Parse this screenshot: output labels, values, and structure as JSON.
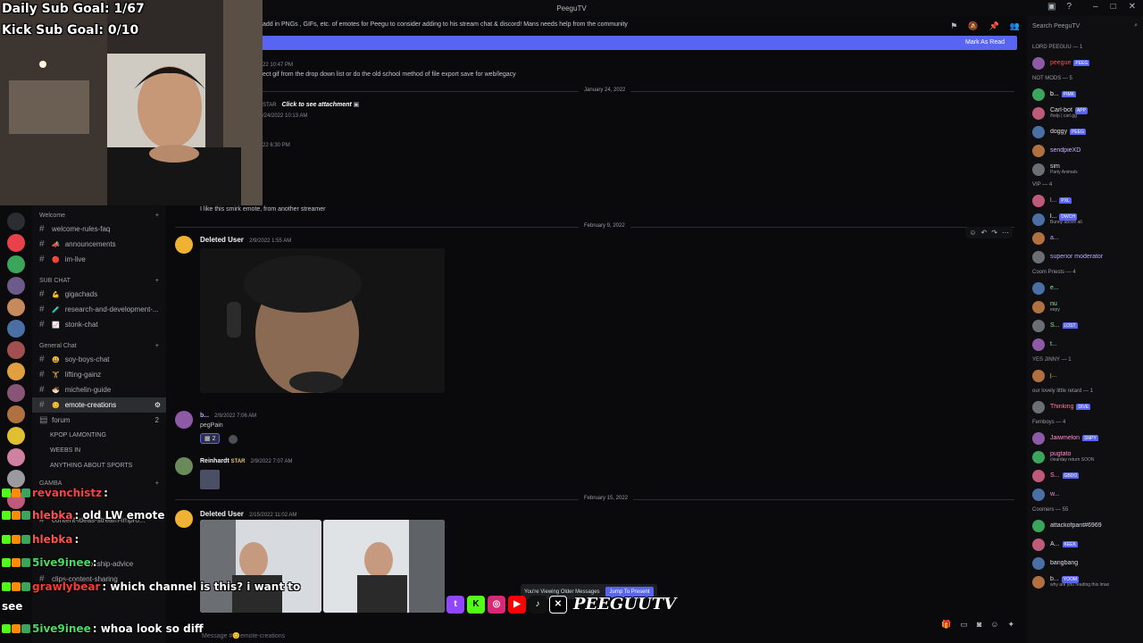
{
  "window": {
    "title": "PeeguTV"
  },
  "overlay": {
    "daily_goal": "Daily Sub Goal: 1/67",
    "kick_goal": "Kick Sub Goal: 0/10",
    "chat": [
      {
        "user": "revanchistz",
        "text": ":",
        "user_color": "#ff4040"
      },
      {
        "user": "hlebka",
        "text": ": old LW emote",
        "user_color": "#ff5252"
      },
      {
        "user": "hlebka",
        "text": ":",
        "user_color": "#ff5252"
      },
      {
        "user": "5ive9inee",
        "text": ":",
        "user_color": "#4cd964"
      },
      {
        "user": "grawlybear",
        "text": ": which channel is this? i want to",
        "user_color": "#ff3b30"
      },
      {
        "user": "",
        "text": "see"
      },
      {
        "user": "5ive9inee",
        "text": ": whoa look so diff",
        "user_color": "#4cd964"
      }
    ],
    "logo": "PEEGUUTV",
    "socials": [
      "twitch-icon",
      "kick-icon",
      "instagram-icon",
      "youtube-icon",
      "tiktok-icon",
      "x-icon"
    ]
  },
  "sidebar": {
    "categories": [
      {
        "name": "Welcome",
        "channels": [
          {
            "label": "welcome-rules-faq",
            "emoji": ""
          },
          {
            "label": "announcements",
            "emoji": "📣"
          },
          {
            "label": "im-live",
            "emoji": "🔴"
          }
        ]
      },
      {
        "name": "SUB CHAT",
        "channels": [
          {
            "label": "gigachads",
            "emoji": "💪"
          },
          {
            "label": "research-and-development-...",
            "emoji": "🧪"
          },
          {
            "label": "stonk-chat",
            "emoji": "📈"
          }
        ]
      },
      {
        "name": "General Chat",
        "channels": [
          {
            "label": "soy-boys-chat",
            "emoji": "😃"
          },
          {
            "label": "lifting-gainz",
            "emoji": "🏋"
          },
          {
            "label": "michelin-guide",
            "emoji": "🍜"
          },
          {
            "label": "emote-creations",
            "emoji": "😊",
            "active": true
          }
        ]
      }
    ],
    "forum": {
      "label": "forum",
      "count": "2",
      "threads": [
        "KPOP LAMONTING",
        "WEEBS IN",
        "ANYTHING ABOUT SPORTS"
      ]
    },
    "gamba": "GAMBA",
    "extra_channels": [
      "content-ideas-stream-impro...",
      "dating-relationship-advice",
      "clips-content-sharing"
    ]
  },
  "main": {
    "banner": "add in PNGs , GIFs, etc. of emotes for Peegu to consider adding to his stream chat & discord! Mans needs help from the community",
    "mark_as_read": "Mark As Read",
    "old_ts1": "22 10:47 PM",
    "old_msg1": "ect gif from the drop down list or do the old school method of file export save for web/legacy",
    "date1": "January 24, 2022",
    "star_label": "STAR",
    "attachment": "Click to see attachment",
    "old_ts2": "/24/2022 10:13 AM",
    "old_ts3": "22 6:30 PM",
    "smirk_msg": "I like this smirk emote, from another streamer",
    "date2": "February 9, 2022",
    "msg1": {
      "user": "Deleted User",
      "time": "2/9/2022 1:55 AM"
    },
    "msg2": {
      "user": "b...",
      "time": "2/9/2022 7:06 AM",
      "text": "pegPain",
      "reaction_count": "2"
    },
    "msg3": {
      "user": "Reinhardt",
      "badge": "STAR",
      "time": "2/9/2022 7:07 AM"
    },
    "date3": "February 15, 2022",
    "msg4": {
      "user": "Deleted User",
      "time": "2/15/2022 11:02 AM"
    },
    "older_label": "You're Viewing Older Messages",
    "jump_label": "Jump To Present",
    "composer_placeholder": "Message #😊emote-creations"
  },
  "members": {
    "search_placeholder": "Search PeeguTV",
    "groups": [
      {
        "title": "LORD PEEGUU — 1",
        "members": [
          {
            "name": "peegue",
            "color": "#ff4b4b",
            "badge": "PEEG"
          }
        ]
      },
      {
        "title": "NOT MODS — 5",
        "members": [
          {
            "name": "b...",
            "color": "#ffffff",
            "badge": "PIMK"
          },
          {
            "name": "Carl-bot",
            "color": "#dbdee1",
            "badge": "APP",
            "sub": "/help | carl.gg"
          },
          {
            "name": "doggy",
            "color": "#dbdee1",
            "badge": "PEEG"
          },
          {
            "name": "sendpieXD",
            "color": "#c7b3ff"
          },
          {
            "name": "sim",
            "color": "#dbdee1",
            "sub": "Party Animals"
          }
        ]
      },
      {
        "title": "VIP — 4",
        "members": [
          {
            "name": "l...",
            "color": "#c7a0ff",
            "badge": "PXL"
          },
          {
            "name": "l...",
            "color": "#ffffff",
            "badge": "DWCH",
            "sub": "Bunny above all."
          },
          {
            "name": "a...",
            "color": "#c7a0ff"
          },
          {
            "name": "superior moderator",
            "color": "#b9a8ff"
          }
        ]
      },
      {
        "title": "Coom Priests — 4",
        "members": [
          {
            "name": "e...",
            "color": "#8fe3a0"
          },
          {
            "name": "nu",
            "color": "#8fe3a0",
            "sub": "eepy"
          },
          {
            "name": "S...",
            "color": "#8fe3a0",
            "badge": "LOST"
          },
          {
            "name": "t...",
            "color": "#8fe3a0"
          }
        ]
      },
      {
        "title": "YES JINNY — 1",
        "members": [
          {
            "name": "j...",
            "color": "#e6c04d"
          }
        ]
      },
      {
        "title": "our lovely little retard — 1",
        "members": [
          {
            "name": "Thinking",
            "color": "#ff7b9c",
            "badge": "DIVE"
          }
        ]
      },
      {
        "title": "Femboys — 4",
        "members": [
          {
            "name": "Jaiwmelon",
            "color": "#ff8fd0",
            "badge": "SNPY"
          },
          {
            "name": "pugtato",
            "color": "#ff8fd0",
            "sub": "clearday return SOON"
          },
          {
            "name": "S...",
            "color": "#ff8fd0",
            "badge": "GBDO"
          },
          {
            "name": "w...",
            "color": "#ff8fd0"
          }
        ]
      },
      {
        "title": "Coomers — 55",
        "members": [
          {
            "name": "attackofpant#6969",
            "color": "#dbdee1"
          },
          {
            "name": "A...",
            "color": "#dbdee1",
            "badge": "KEEK"
          },
          {
            "name": "bangbang",
            "color": "#dbdee1"
          },
          {
            "name": "b...",
            "color": "#dbdee1",
            "badge": "YOOM",
            "sub": "why are you reading this lmao"
          }
        ]
      }
    ]
  },
  "colors": {
    "accent": "#5865f2",
    "background": "#0a0a0c",
    "sidebar": "#0f0f11"
  }
}
